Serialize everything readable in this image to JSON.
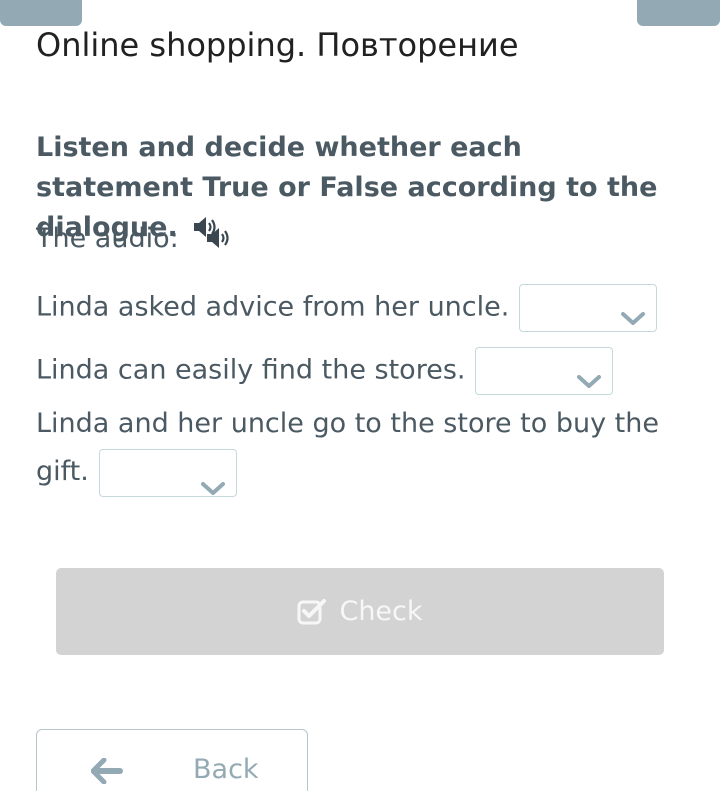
{
  "header": {
    "title": "Online shopping. Повторение"
  },
  "exercise": {
    "instruction": "Listen and decide whether each statement True or False according to the dialogue.",
    "audio_label": "The audio:",
    "questions": [
      {
        "text": "Linda asked advice from her uncle.",
        "selected": ""
      },
      {
        "text": "Linda can easily find the stores.",
        "selected": ""
      },
      {
        "text": "Linda and her uncle go to the store to buy the gift.",
        "selected": ""
      }
    ]
  },
  "actions": {
    "check_label": "Check",
    "back_label": "Back"
  },
  "icons": {
    "speaker": "speaker-icon",
    "chevron": "chevron-down-icon",
    "check": "check-square-icon",
    "back": "arrow-left-icon"
  },
  "colors": {
    "accent": "#93aab4",
    "text": "#4b5963",
    "dropdown_border": "#c5d8dc",
    "check_bg": "#d3d3d3"
  }
}
